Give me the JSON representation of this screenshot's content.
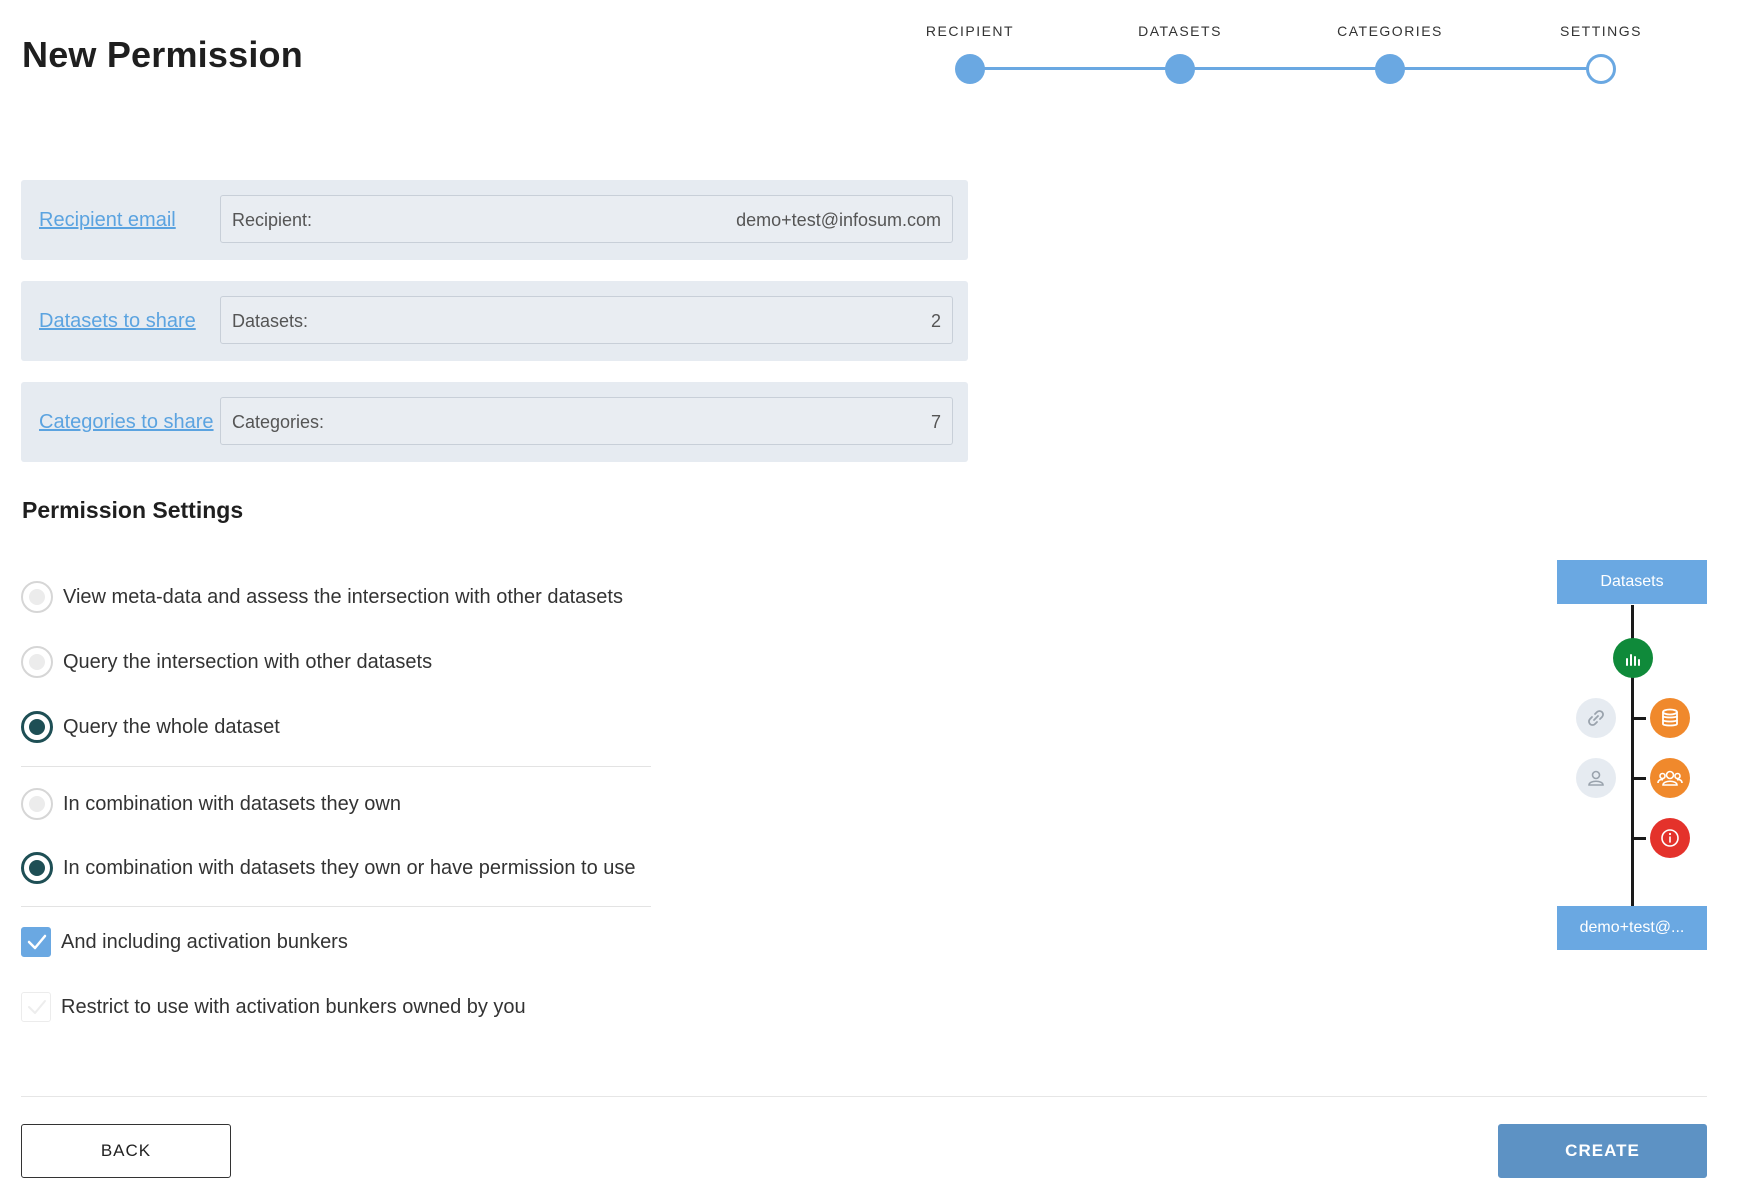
{
  "page": {
    "title": "New Permission"
  },
  "stepper": {
    "steps": [
      {
        "label": "RECIPIENT",
        "state": "complete"
      },
      {
        "label": "DATASETS",
        "state": "complete"
      },
      {
        "label": "CATEGORIES",
        "state": "complete"
      },
      {
        "label": "SETTINGS",
        "state": "current"
      }
    ],
    "accent_color": "#6aa8e2"
  },
  "summary": {
    "recipient": {
      "link": "Recipient email",
      "label": "Recipient:",
      "value": "demo+test@infosum.com"
    },
    "datasets": {
      "link": "Datasets to share",
      "label": "Datasets:",
      "value": "2"
    },
    "categories": {
      "link": "Categories to share",
      "label": "Categories:",
      "value": "7"
    }
  },
  "settings": {
    "title": "Permission Settings",
    "access_options": [
      {
        "label": "View meta-data and assess the intersection with other datasets",
        "checked": false
      },
      {
        "label": "Query the intersection with other datasets",
        "checked": false
      },
      {
        "label": "Query the whole dataset",
        "checked": true
      }
    ],
    "combination_options": [
      {
        "label": "In combination with datasets they own",
        "checked": false
      },
      {
        "label": "In combination with datasets they own or have permission to use",
        "checked": true
      }
    ],
    "bunker_options": [
      {
        "label": "And including activation bunkers",
        "checked": true
      },
      {
        "label": "Restrict to use with activation bunkers owned by you",
        "checked": false
      }
    ]
  },
  "diagram": {
    "top_label": "Datasets",
    "bottom_label": "demo+test@...",
    "icons": [
      "bar-chart-icon",
      "link-icon",
      "database-icon",
      "user-icon",
      "group-icon",
      "info-icon"
    ],
    "colors": {
      "green": "#0f8a3a",
      "orange": "#f0892c",
      "red": "#e4322b",
      "box": "#6aa8e2"
    }
  },
  "actions": {
    "back_label": "BACK",
    "create_label": "CREATE"
  }
}
